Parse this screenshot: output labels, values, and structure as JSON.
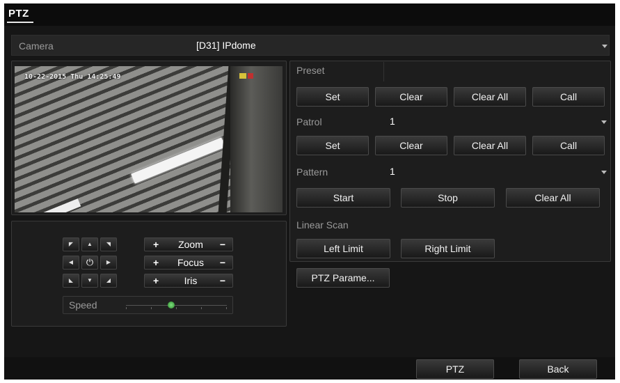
{
  "window": {
    "title": "PTZ"
  },
  "camera": {
    "label": "Camera",
    "value": "[D31] IPdome"
  },
  "video": {
    "osd_text": "10-22-2015 Thu 14:25:49"
  },
  "preset": {
    "label": "Preset",
    "buttons": [
      "Set",
      "Clear",
      "Clear All",
      "Call"
    ]
  },
  "patrol": {
    "label": "Patrol",
    "value": "1",
    "buttons": [
      "Set",
      "Clear",
      "Clear All",
      "Call"
    ]
  },
  "pattern": {
    "label": "Pattern",
    "value": "1",
    "buttons": [
      "Start",
      "Stop",
      "Clear All"
    ]
  },
  "linear_scan": {
    "label": "Linear Scan",
    "buttons": [
      "Left Limit",
      "Right Limit"
    ]
  },
  "ptz_params_button": "PTZ Parame...",
  "controls": {
    "zoom": {
      "plus": "+",
      "label": "Zoom",
      "minus": "−"
    },
    "focus": {
      "plus": "+",
      "label": "Focus",
      "minus": "−"
    },
    "iris": {
      "plus": "+",
      "label": "Iris",
      "minus": "−"
    },
    "direction_pad": {
      "up_left": "◤",
      "up": "▲",
      "up_right": "◥",
      "left": "◀",
      "center": "⏻",
      "right": "▶",
      "down_left": "◣",
      "down": "▼",
      "down_right": "◢"
    }
  },
  "speed": {
    "label": "Speed",
    "level": 0.45
  },
  "footer": {
    "ptz_button": "PTZ",
    "back_button": "Back"
  }
}
